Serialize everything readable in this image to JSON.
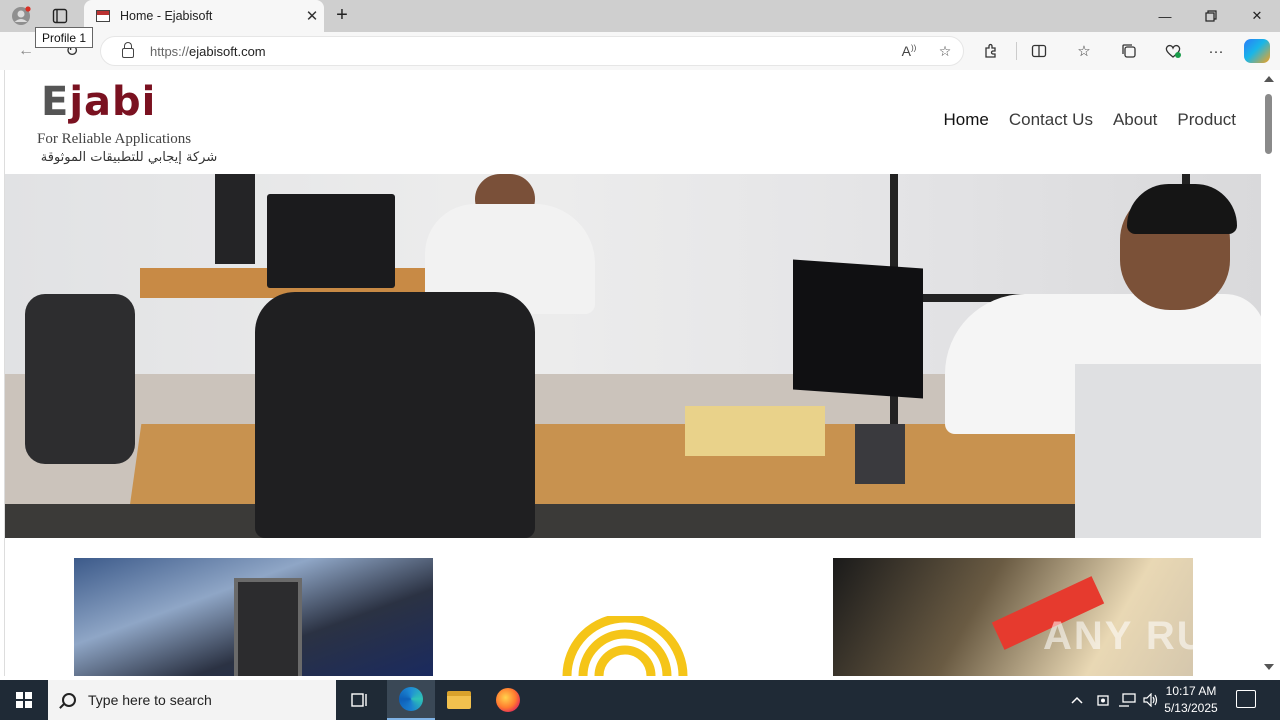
{
  "browser": {
    "tab_title": "Home - Ejabisoft",
    "tooltip": "Profile 1",
    "url_protocol": "https://",
    "url_host": "ejabisoft.com"
  },
  "site": {
    "logo_word_e": "E",
    "logo_word_rest": "jabi",
    "logo_tagline": "For Reliable Applications",
    "logo_arabic": "شركة إيجابي للتطبيقات الموثوقة",
    "menu": [
      {
        "label": "Home",
        "active": true
      },
      {
        "label": "Contact Us",
        "active": false
      },
      {
        "label": "About",
        "active": false
      },
      {
        "label": "Product",
        "active": false
      }
    ]
  },
  "watermark": "ANY RUN",
  "taskbar": {
    "search_placeholder": "Type here to search",
    "time": "10:17 AM",
    "date": "5/13/2025"
  },
  "colors": {
    "brand_red": "#7a1120",
    "logo_gray": "#555555",
    "taskbar_bg": "#1f2a36",
    "card_yellow": "#f5c518"
  }
}
